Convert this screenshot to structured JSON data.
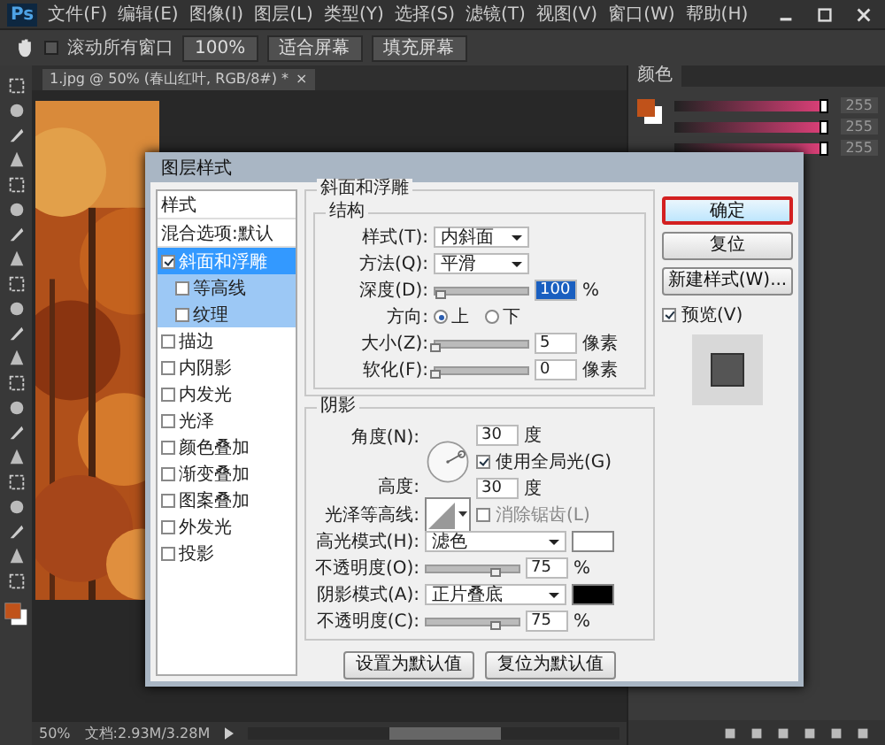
{
  "menubar": {
    "logo": "Ps",
    "items": [
      "文件(F)",
      "编辑(E)",
      "图像(I)",
      "图层(L)",
      "类型(Y)",
      "选择(S)",
      "滤镜(T)",
      "视图(V)",
      "窗口(W)",
      "帮助(H)"
    ]
  },
  "options_bar": {
    "scroll_all": {
      "label": "滚动所有窗口",
      "checked": false
    },
    "buttons": [
      "100%",
      "适合屏幕",
      "填充屏幕"
    ]
  },
  "document_tab": {
    "title": "1.jpg @ 50% (春山红叶, RGB/8#) *",
    "close": "×"
  },
  "color_panel": {
    "tab": "颜色",
    "rows": [
      {
        "value": "255",
        "level": 1
      },
      {
        "value": "255",
        "level": 1
      },
      {
        "value": "255",
        "level": 1
      }
    ]
  },
  "status_bar": {
    "zoom": "50%",
    "doc": "文档:2.93M/3.28M"
  },
  "dialog": {
    "title": "图层样式",
    "styles": [
      {
        "kind": "header",
        "label": "样式"
      },
      {
        "kind": "header",
        "label": "混合选项:默认"
      },
      {
        "kind": "effect",
        "label": "斜面和浮雕",
        "checked": true,
        "selected": true,
        "children": [
          {
            "label": "等高线",
            "checked": false,
            "selected": false
          },
          {
            "label": "纹理",
            "checked": false,
            "selected": false
          }
        ]
      },
      {
        "kind": "effect",
        "label": "描边",
        "checked": false,
        "selected": false
      },
      {
        "kind": "effect",
        "label": "内阴影",
        "checked": false,
        "selected": false
      },
      {
        "kind": "effect",
        "label": "内发光",
        "checked": false,
        "selected": false
      },
      {
        "kind": "effect",
        "label": "光泽",
        "checked": false,
        "selected": false
      },
      {
        "kind": "effect",
        "label": "颜色叠加",
        "checked": false,
        "selected": false
      },
      {
        "kind": "effect",
        "label": "渐变叠加",
        "checked": false,
        "selected": false
      },
      {
        "kind": "effect",
        "label": "图案叠加",
        "checked": false,
        "selected": false
      },
      {
        "kind": "effect",
        "label": "外发光",
        "checked": false,
        "selected": false
      },
      {
        "kind": "effect",
        "label": "投影",
        "checked": false,
        "selected": false
      }
    ],
    "bevel": {
      "title": "斜面和浮雕",
      "structure": {
        "title": "结构",
        "style": {
          "label": "样式(T):",
          "value": "内斜面"
        },
        "technique": {
          "label": "方法(Q):",
          "value": "平滑"
        },
        "depth": {
          "label": "深度(D):",
          "level": 0.05,
          "value": "100",
          "unit": "%"
        },
        "direction": {
          "label": "方向:",
          "options": [
            {
              "label": "上",
              "selected": true
            },
            {
              "label": "下",
              "selected": false
            }
          ]
        },
        "size": {
          "label": "大小(Z):",
          "level": 0,
          "value": "5",
          "unit": "像素"
        },
        "soften": {
          "label": "软化(F):",
          "level": 0,
          "value": "0",
          "unit": "像素"
        }
      }
    },
    "shading": {
      "title": "阴影",
      "angle": {
        "label": "角度(N):",
        "value": "30",
        "unit": "度"
      },
      "global_light": {
        "label": "使用全局光(G)",
        "checked": true
      },
      "altitude": {
        "label": "高度:",
        "value": "30",
        "unit": "度"
      },
      "gloss": {
        "label": "光泽等高线:"
      },
      "anti_alias": {
        "label": "消除锯齿(L)",
        "checked": false
      },
      "modes": [
        {
          "label": "高光模式(H):",
          "value": "滤色",
          "color": "#ffffff",
          "opacity_label": "不透明度(O):",
          "level": 0.75,
          "opacity": "75",
          "unit": "%"
        },
        {
          "label": "阴影模式(A):",
          "value": "正片叠底",
          "color": "#000000",
          "opacity_label": "不透明度(C):",
          "level": 0.75,
          "opacity": "75",
          "unit": "%"
        }
      ]
    },
    "bottom_buttons": [
      "设置为默认值",
      "复位为默认值"
    ],
    "side_buttons": [
      {
        "label": "确定",
        "kind": "primary"
      },
      {
        "label": "复位",
        "kind": "normal"
      },
      {
        "label": "新建样式(W)...",
        "kind": "normal"
      }
    ],
    "preview": {
      "label": "预览(V)",
      "checked": true
    }
  }
}
